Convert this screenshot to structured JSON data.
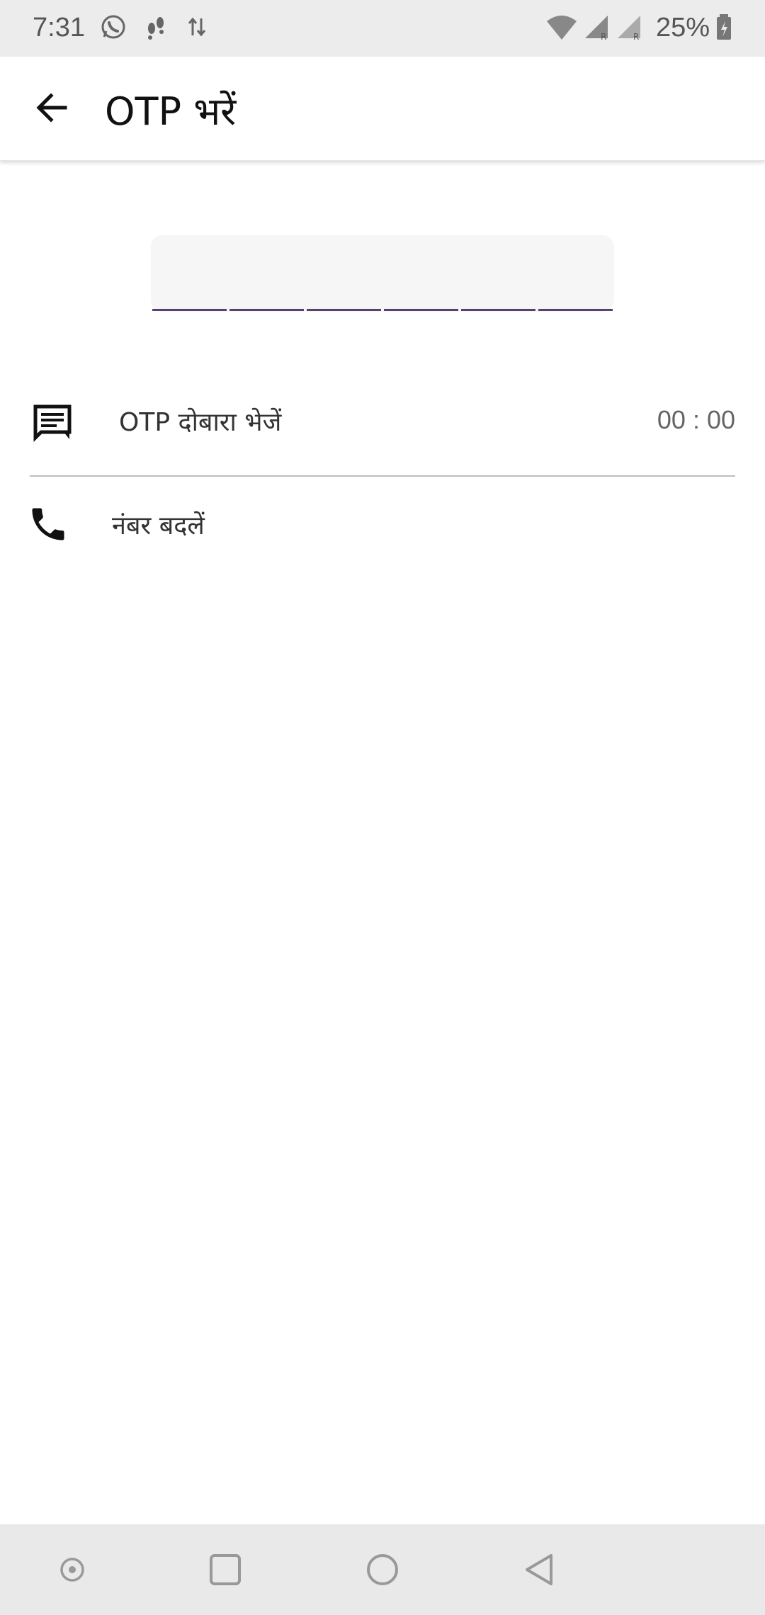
{
  "status_bar": {
    "time": "7:31",
    "battery": "25%",
    "icons": [
      "whatsapp-icon",
      "footsteps-icon",
      "data-transfer-icon",
      "wifi-icon",
      "signal-r-icon",
      "signal-r-icon",
      "battery-charging-icon"
    ]
  },
  "app_bar": {
    "title": "OTP भरें",
    "back_icon": "arrow-back-icon"
  },
  "otp": {
    "digit_count": 6,
    "values": [
      "",
      "",
      "",
      "",
      "",
      ""
    ],
    "underline_color": "#5a4070"
  },
  "resend": {
    "icon": "message-icon",
    "label": "OTP दोबारा भेजें",
    "timer": "00 : 00"
  },
  "change_number": {
    "icon": "phone-icon",
    "label": "नंबर बदलें"
  },
  "nav_bar": {
    "icons": [
      "assistant-icon",
      "recents-square-icon",
      "home-circle-icon",
      "back-triangle-icon"
    ]
  }
}
